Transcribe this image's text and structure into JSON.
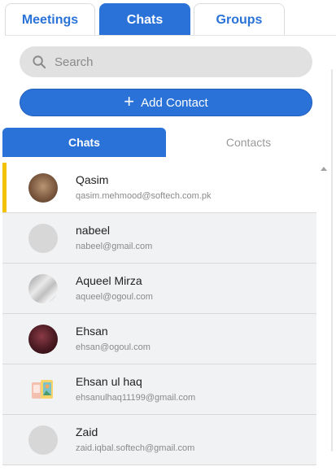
{
  "top_tabs": [
    {
      "label": "Meetings",
      "active": false
    },
    {
      "label": "Chats",
      "active": true
    },
    {
      "label": "Groups",
      "active": false
    }
  ],
  "search": {
    "placeholder": "Search",
    "icon": "search-icon"
  },
  "add_contact": {
    "label": "Add Contact",
    "icon": "plus-icon"
  },
  "inner_tabs": [
    {
      "label": "Chats",
      "active": true
    },
    {
      "label": "Contacts",
      "active": false
    }
  ],
  "contacts": [
    {
      "name": "Qasim",
      "email": "qasim.mehmood@softech.com.pk",
      "selected": true
    },
    {
      "name": "nabeel",
      "email": "nabeel@gmail.com",
      "selected": false
    },
    {
      "name": "Aqueel Mirza",
      "email": "aqueel@ogoul.com",
      "selected": false
    },
    {
      "name": "Ehsan",
      "email": "ehsan@ogoul.com",
      "selected": false
    },
    {
      "name": "Ehsan ul haq",
      "email": "ehsanulhaq11199@gmail.com",
      "selected": false
    },
    {
      "name": "Zaid",
      "email": "zaid.iqbal.softech@gmail.com",
      "selected": false
    }
  ],
  "colors": {
    "accent": "#2a72d8",
    "selected_marker": "#f2c200"
  }
}
